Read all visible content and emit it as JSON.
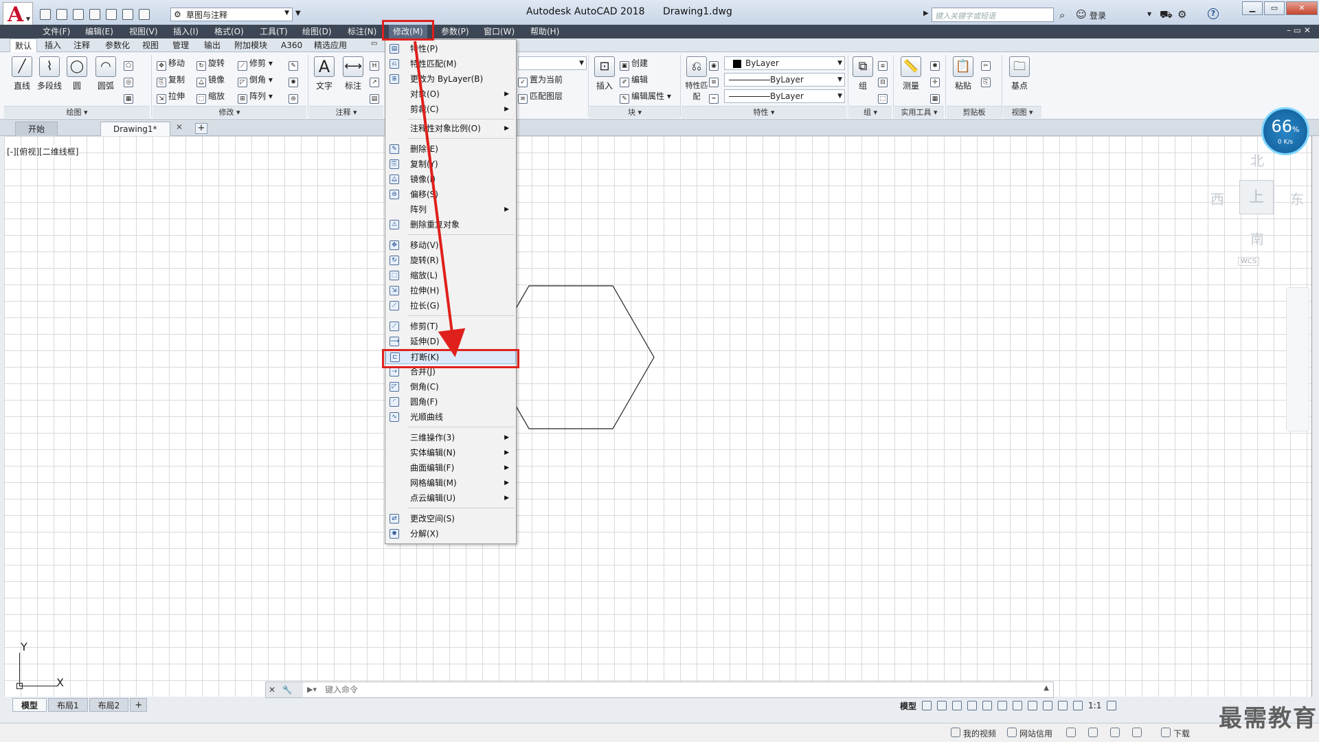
{
  "titlebar": {
    "workspace": "草图与注释",
    "app_name": "Autodesk AutoCAD 2018",
    "file_name": "Drawing1.dwg",
    "search_placeholder": "键入关键字或短语",
    "login": "登录"
  },
  "menubar": {
    "items": [
      "文件(F)",
      "编辑(E)",
      "视图(V)",
      "插入(I)",
      "格式(O)",
      "工具(T)",
      "绘图(D)",
      "标注(N)",
      "修改(M)",
      "参数(P)",
      "窗口(W)",
      "帮助(H)"
    ],
    "active": "修改(M)"
  },
  "ribbon_tabs": [
    "默认",
    "插入",
    "注释",
    "参数化",
    "视图",
    "管理",
    "输出",
    "附加模块",
    "A360",
    "精选应用"
  ],
  "ribbon": {
    "draw": {
      "title": "绘图",
      "tools": [
        "直线",
        "多段线",
        "圆",
        "圆弧"
      ]
    },
    "modify": {
      "title": "修改",
      "tools": [
        "移动",
        "旋转",
        "修剪",
        "复制",
        "镜像",
        "倒角",
        "拉伸",
        "缩放",
        "阵列"
      ]
    },
    "annotation": {
      "title": "注释",
      "tools": [
        "文字",
        "标注"
      ]
    },
    "block": {
      "title": "块",
      "tools": [
        "插入",
        "创建",
        "编辑",
        "编辑属性"
      ]
    },
    "layers": {
      "tools": [
        "置为当前",
        "匹配图层"
      ]
    },
    "properties": {
      "title": "特性",
      "match": "特性匹配",
      "color": "ByLayer",
      "linetype": "ByLayer",
      "lineweight": "ByLayer"
    },
    "group": {
      "title": "组",
      "tool": "组"
    },
    "utilities": {
      "title": "实用工具",
      "tool": "测量"
    },
    "clipboard": {
      "title": "剪贴板",
      "tool": "粘贴"
    },
    "view": {
      "title": "视图",
      "tool": "基点"
    }
  },
  "file_tabs": {
    "start": "开始",
    "drawing": "Drawing1*"
  },
  "viewport_label": "[-][俯视][二维线框]",
  "viewcube": {
    "north": "北",
    "south": "南",
    "east": "东",
    "west": "西",
    "face": "上",
    "wcs": "WCS"
  },
  "perf": {
    "percent": "66",
    "unit": "%",
    "speed": "0 K/s"
  },
  "ucs": {
    "x": "X",
    "y": "Y"
  },
  "modify_menu": {
    "items": [
      {
        "label": "特性(P)",
        "icon": "properties-icon",
        "submenu": false
      },
      {
        "label": "特性匹配(M)",
        "icon": "match-properties-icon",
        "submenu": false
      },
      {
        "label": "更改为 ByLayer(B)",
        "icon": "bylayer-icon",
        "submenu": false
      },
      {
        "label": "对象(O)",
        "icon": "",
        "submenu": true
      },
      {
        "label": "剪裁(C)",
        "icon": "",
        "submenu": true
      },
      {
        "label": "注释性对象比例(O)",
        "icon": "",
        "submenu": true
      },
      {
        "label": "删除(E)",
        "icon": "erase-icon",
        "submenu": false
      },
      {
        "label": "复制(Y)",
        "icon": "copy-icon",
        "submenu": false
      },
      {
        "label": "镜像(I)",
        "icon": "mirror-icon",
        "submenu": false
      },
      {
        "label": "偏移(S)",
        "icon": "offset-icon",
        "submenu": false
      },
      {
        "label": "阵列",
        "icon": "",
        "submenu": true
      },
      {
        "label": "删除重复对象",
        "icon": "overkill-icon",
        "submenu": false
      },
      {
        "label": "移动(V)",
        "icon": "move-icon",
        "submenu": false
      },
      {
        "label": "旋转(R)",
        "icon": "rotate-icon",
        "submenu": false
      },
      {
        "label": "缩放(L)",
        "icon": "scale-icon",
        "submenu": false
      },
      {
        "label": "拉伸(H)",
        "icon": "stretch-icon",
        "submenu": false
      },
      {
        "label": "拉长(G)",
        "icon": "lengthen-icon",
        "submenu": false
      },
      {
        "label": "修剪(T)",
        "icon": "trim-icon",
        "submenu": false
      },
      {
        "label": "延伸(D)",
        "icon": "extend-icon",
        "submenu": false
      },
      {
        "label": "打断(K)",
        "icon": "break-icon",
        "submenu": false
      },
      {
        "label": "合并(J)",
        "icon": "join-icon",
        "submenu": false
      },
      {
        "label": "倒角(C)",
        "icon": "chamfer-icon",
        "submenu": false
      },
      {
        "label": "圆角(F)",
        "icon": "fillet-icon",
        "submenu": false
      },
      {
        "label": "光顺曲线",
        "icon": "blend-icon",
        "submenu": false
      },
      {
        "label": "三维操作(3)",
        "icon": "",
        "submenu": true
      },
      {
        "label": "实体编辑(N)",
        "icon": "",
        "submenu": true
      },
      {
        "label": "曲面编辑(F)",
        "icon": "",
        "submenu": true
      },
      {
        "label": "网格编辑(M)",
        "icon": "",
        "submenu": true
      },
      {
        "label": "点云编辑(U)",
        "icon": "",
        "submenu": true
      },
      {
        "label": "更改空间(S)",
        "icon": "change-space-icon",
        "submenu": false
      },
      {
        "label": "分解(X)",
        "icon": "explode-icon",
        "submenu": false
      }
    ],
    "highlighted": "打断(K)"
  },
  "command": {
    "placeholder": "键入命令"
  },
  "layout_tabs": [
    "模型",
    "布局1",
    "布局2"
  ],
  "status": {
    "model": "模型",
    "scale": "1:1"
  },
  "taskbar": {
    "video": "我的视频",
    "net": "网站信用",
    "download": "下载"
  },
  "watermark": "最需教育",
  "colors": {
    "annotation": "#e0201c",
    "menubar": "#3c4654",
    "accent": "#1d4f8f"
  }
}
